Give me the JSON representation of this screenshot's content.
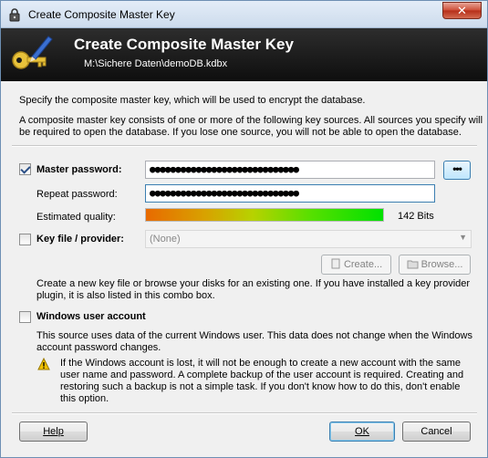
{
  "window": {
    "title": "Create Composite Master Key",
    "close_glyph": "✕"
  },
  "banner": {
    "title": "Create Composite Master Key",
    "subtitle": "M:\\Sichere Daten\\demoDB.kdbx"
  },
  "intro": {
    "line1": "Specify the composite master key, which will be used to encrypt the database.",
    "line2": "A composite master key consists of one or more of the following key sources. All sources you specify will",
    "line3": "be required to open the database.  If you lose one source, you will not be able to open the database."
  },
  "master_password": {
    "checked": true,
    "label": "Master password:",
    "value": "●●●●●●●●●●●●●●●●●●●●●●●●●●●●●",
    "reveal_button": "•••",
    "repeat_label": "Repeat password:",
    "repeat_value": "●●●●●●●●●●●●●●●●●●●●●●●●●●●●●",
    "quality_label": "Estimated quality:",
    "quality_fraction": 1.0,
    "quality_text": "142 Bits"
  },
  "key_file": {
    "checked": false,
    "label": "Key file / provider:",
    "selected": "(None)",
    "create_button": "Create...",
    "browse_button": "Browse...",
    "desc1": "Create a new key file or browse your disks for an existing one. If you have installed a key provider",
    "desc2": "plugin, it is also listed in this combo box."
  },
  "windows_account": {
    "checked": false,
    "label": "Windows user account",
    "desc1": "This source uses data of the current Windows user. This data does not change when the Windows",
    "desc2": "account password changes.",
    "warn1": "If the Windows account is lost, it will not be enough to create a new account with the same",
    "warn2": "user name and password. A complete backup of the user account is required. Creating and",
    "warn3": "restoring such a backup is not a simple task.  If you don't know how to do this, don't enable",
    "warn4": "this option."
  },
  "footer": {
    "help_button": "Help",
    "ok_button": "OK",
    "cancel_button": "Cancel"
  }
}
